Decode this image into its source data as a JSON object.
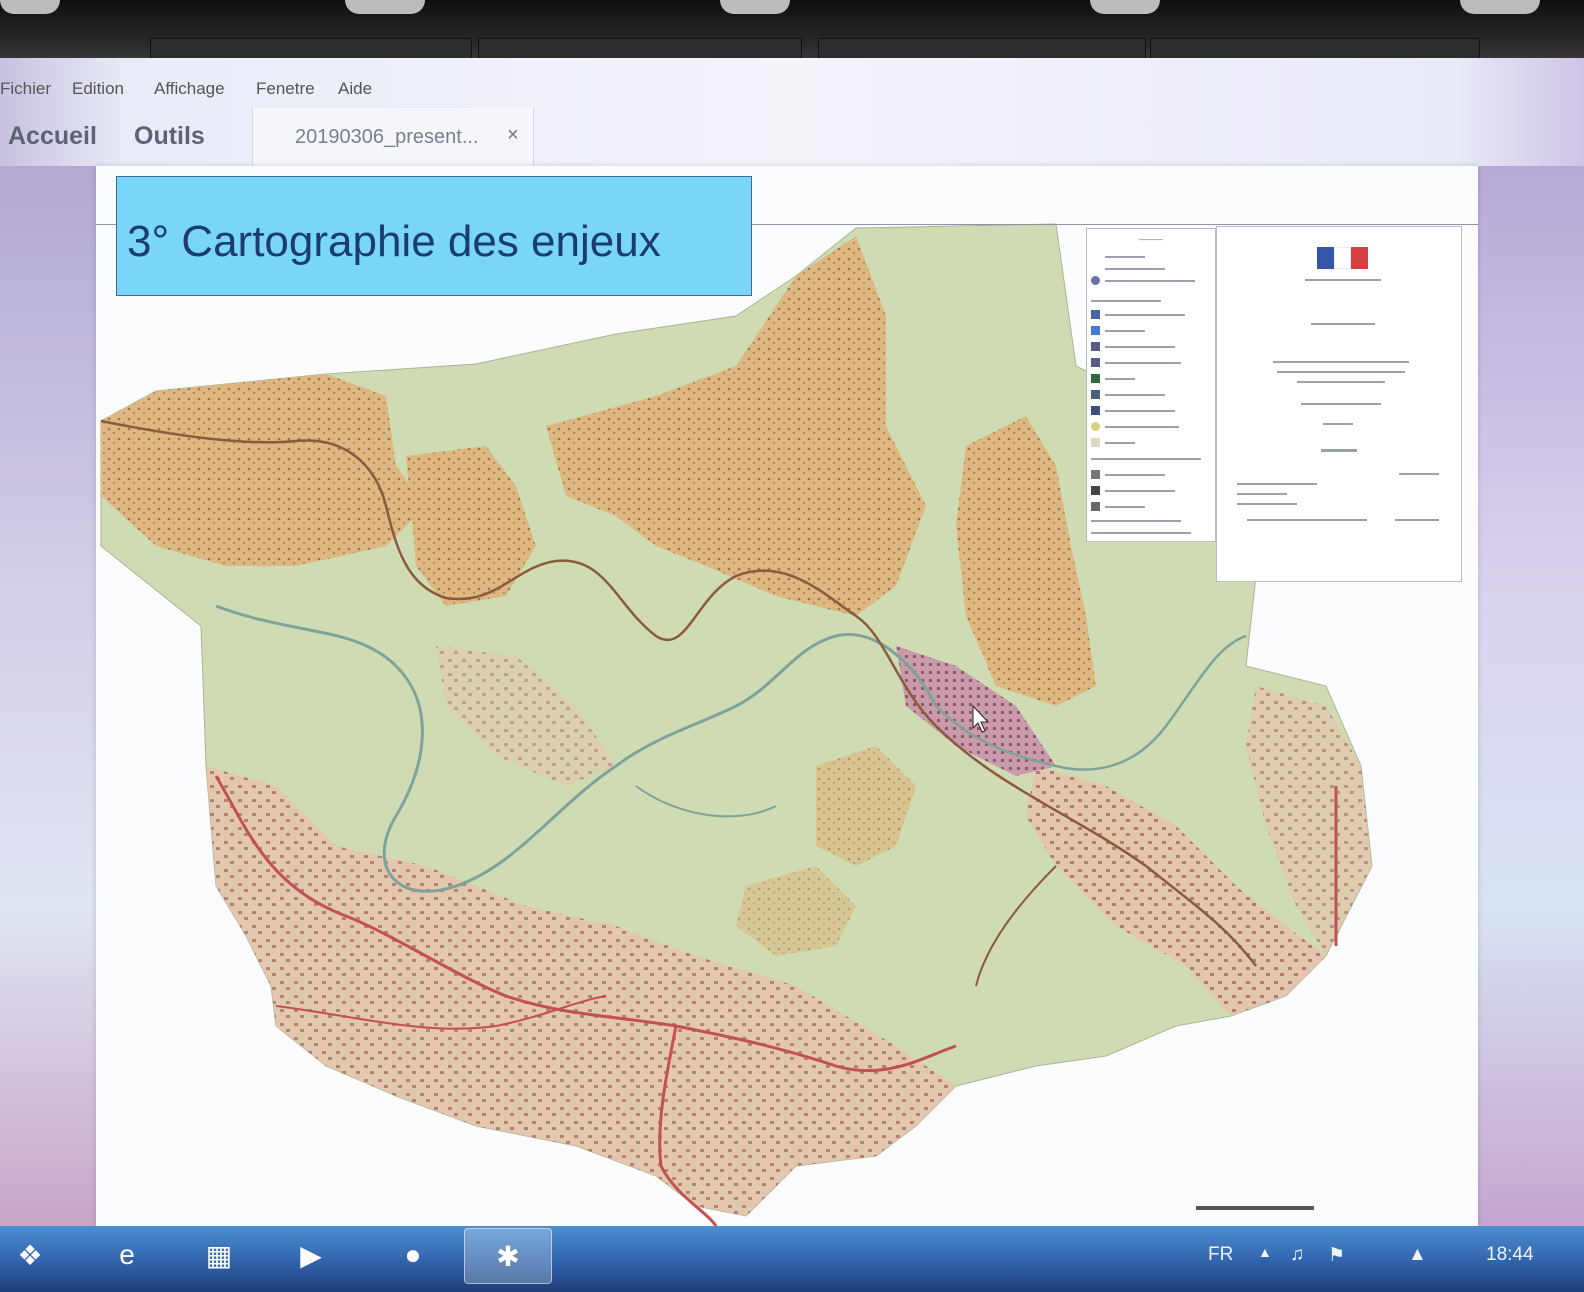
{
  "menu": {
    "items": [
      "Fichier",
      "Edition",
      "Affichage",
      "Fenetre",
      "Aide"
    ]
  },
  "toolbar": {
    "home_label": "Accueil",
    "tools_label": "Outils",
    "doc_tab_label": "20190306_present...",
    "close_glyph": "×"
  },
  "slide": {
    "title": "3° Cartographie des enjeux"
  },
  "colors": {
    "title_box": "#79d6f7",
    "map_green": "#cfdcb3",
    "map_orange": "#ddb883",
    "map_urban": "#e6b6a2",
    "road_red": "#c45050"
  },
  "taskbar": {
    "language": "FR",
    "time": "18:44",
    "apps": [
      "start-orb-icon",
      "internet-explorer-icon",
      "file-explorer-icon",
      "media-player-icon",
      "firefox-icon",
      "adobe-reader-icon"
    ]
  }
}
